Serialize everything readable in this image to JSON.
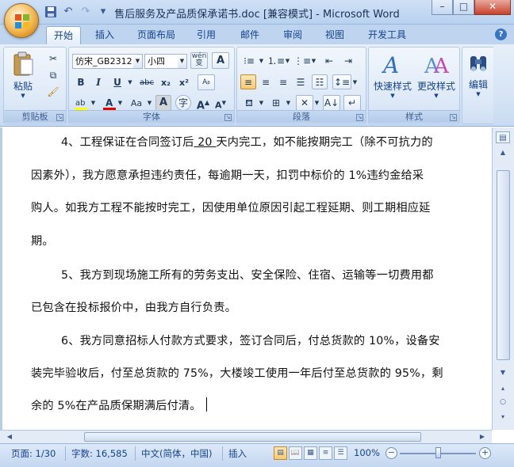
{
  "window": {
    "title": "售后服务及产品质保承诺书.doc [兼容模式] - Microsoft Word",
    "minimize": "–",
    "maximize": "□",
    "close": "✕"
  },
  "qat": {
    "save": "save-icon",
    "undo": "undo-icon",
    "redo": "redo-icon",
    "more": "▾"
  },
  "tabs": [
    {
      "label": "开始",
      "active": true
    },
    {
      "label": "插入"
    },
    {
      "label": "页面布局"
    },
    {
      "label": "引用"
    },
    {
      "label": "邮件"
    },
    {
      "label": "审阅"
    },
    {
      "label": "视图"
    },
    {
      "label": "开发工具"
    }
  ],
  "help": "?",
  "ribbon": {
    "clipboard": {
      "label": "剪贴板",
      "paste": "粘贴"
    },
    "font": {
      "label": "字体",
      "font_name": "仿宋_GB2312",
      "font_size": "小四",
      "bold": "B",
      "italic": "I",
      "underline": "U",
      "strike": "abc",
      "subscript": "x₂",
      "superscript": "x²",
      "change_case": "Aa"
    },
    "paragraph": {
      "label": "段落"
    },
    "styles": {
      "label": "样式",
      "quick_styles": "快速样式",
      "change_styles": "更改样式"
    },
    "editing": {
      "label": "编辑"
    }
  },
  "document": {
    "lines": [
      {
        "pre": "4、工程保证在合同签订后",
        "underlined": " 20 ",
        "post": "天内完工，如不能按期完工（除不可抗力的"
      },
      {
        "text": "因素外），我方愿意承担违约责任，每逾期一天，扣罚中标价的 1%违约金给采"
      },
      {
        "text": "购人。如我方工程不能按时完工，因使用单位原因引起工程延期、则工期相应延"
      },
      {
        "text": "期。"
      },
      {
        "text": "5、我方到现场施工所有的劳务支出、安全保险、住宿、运输等一切费用都"
      },
      {
        "text": "已包含在投标报价中，由我方自行负责。"
      },
      {
        "text": "6、我方同意招标人付款方式要求，签订合同后，付总货款的 10%，设备安"
      },
      {
        "text": "装完毕验收后，付至总货款的 75%，大楼竣工使用一年后付至总货款的 95%，剩"
      },
      {
        "text": "余的 5%在产品质保期满后付清。"
      }
    ]
  },
  "status": {
    "page": "页面: 1/30",
    "words": "字数: 16,585",
    "language": "中文(简体，中国)",
    "mode": "插入",
    "zoom": "100%",
    "zoom_out": "−",
    "zoom_in": "+",
    "zoom_level_fraction": 1.0
  }
}
